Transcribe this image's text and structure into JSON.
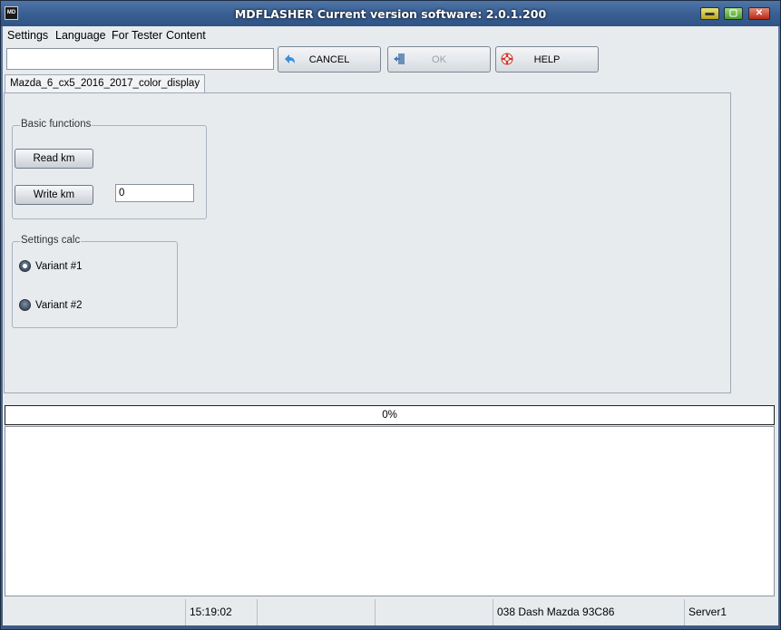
{
  "window": {
    "title": "MDFLASHER  Current version software: 2.0.1.200",
    "app_icon_text": "MD",
    "min_glyph": "▬",
    "max_glyph": "▢",
    "close_glyph": "✕"
  },
  "menu": [
    "Settings",
    "Language",
    "For Tester",
    "Content"
  ],
  "toolbar": {
    "input_value": "",
    "cancel_label": "CANCEL",
    "ok_label": "OK",
    "help_label": "HELP"
  },
  "tabs": [
    {
      "label": "Mazda_6_cx5_2016_2017_color_display",
      "active": true
    }
  ],
  "basic_functions": {
    "legend": "Basic functions",
    "read_km_label": "Read km",
    "write_km_label": "Write km",
    "km_value": "0"
  },
  "settings_calc": {
    "legend": "Settings calc",
    "variants": [
      {
        "label": "Variant #1",
        "checked": true
      },
      {
        "label": "Variant #2",
        "checked": false
      }
    ]
  },
  "progress": {
    "value": 0,
    "text": "0%"
  },
  "log": {
    "content": ""
  },
  "status": {
    "cells": [
      "",
      "15:19:02",
      "",
      "",
      "038 Dash Mazda  93C86",
      "Server1"
    ]
  },
  "colors": {
    "titlebar": "#3a5f93",
    "client_bg": "#e8ebee",
    "progress_fill": "#3c9a3c"
  }
}
